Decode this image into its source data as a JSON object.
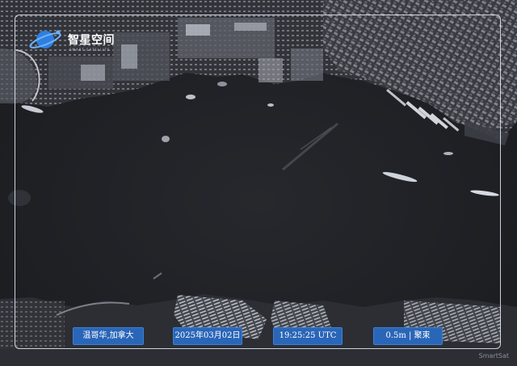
{
  "logo": {
    "name": "智星空间",
    "subtitle": "SMART SATELLITE"
  },
  "labels": {
    "location": "温哥华,加拿大",
    "date": "2025年03月02日",
    "time": "19:25:25 UTC",
    "mode": "0.5m | 聚束"
  },
  "watermark": "SmartSat",
  "colors": {
    "pill": "#2a66b8",
    "frame": "#ebf0fa",
    "background": "#1b1d21"
  }
}
